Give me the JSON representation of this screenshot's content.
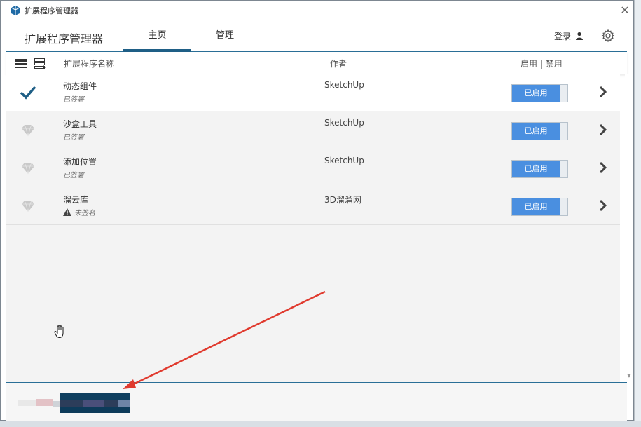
{
  "window": {
    "title": "扩展程序管理器",
    "close_glyph": "✕"
  },
  "header": {
    "app_name": "扩展程序管理器",
    "tabs": [
      {
        "label": "主页",
        "active": true
      },
      {
        "label": "管理",
        "active": false
      }
    ],
    "login_label": "登录"
  },
  "columns": {
    "name": "扩展程序名称",
    "author": "作者",
    "enable": "启用 | 禁用"
  },
  "extensions": [
    {
      "name": "动态组件",
      "signature": "已签署",
      "author": "SketchUp",
      "toggle_label": "已启用",
      "state_icon": "checkmark-icon"
    },
    {
      "name": "沙盒工具",
      "signature": "已签署",
      "author": "SketchUp",
      "toggle_label": "已启用",
      "state_icon": "gem-icon"
    },
    {
      "name": "添加位置",
      "signature": "已签署",
      "author": "SketchUp",
      "toggle_label": "已启用",
      "state_icon": "gem-icon"
    },
    {
      "name": "溜云库",
      "signature": "未签名",
      "author": "3D溜溜网",
      "toggle_label": "已启用",
      "state_icon": "gem-icon",
      "warning": true
    }
  ],
  "colors": {
    "accent": "#1f5f86",
    "toggle_on": "#4a8fe0",
    "annotation_arrow": "#e03a2e"
  }
}
